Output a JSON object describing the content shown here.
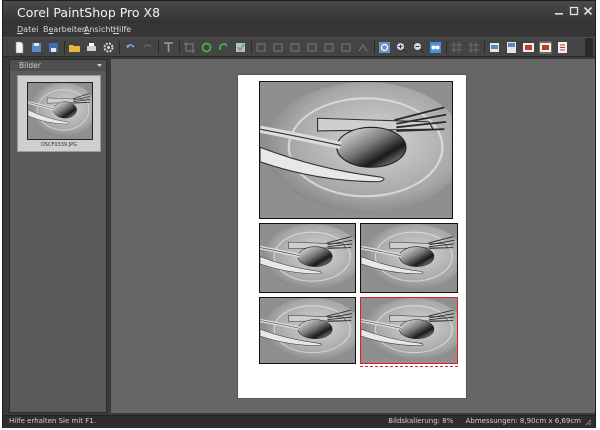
{
  "app": {
    "title": "Corel PaintShop Pro X8"
  },
  "menu": [
    {
      "label": "Datei",
      "accel": "D"
    },
    {
      "label": "Bearbeiten",
      "accel": "e"
    },
    {
      "label": "Ansicht",
      "accel": "A"
    },
    {
      "label": "Hilfe",
      "accel": "H"
    }
  ],
  "sidebar": {
    "title": "Bilder",
    "thumbnail_caption": "DSCF0339.JPG"
  },
  "toolbar": {
    "icons": [
      "new-icon",
      "save-icon",
      "save-as-icon",
      "open-icon",
      "print-icon",
      "settings-icon",
      "undo-icon",
      "redo-icon",
      "text-icon",
      "crop-icon",
      "rotate-right-icon",
      "rotate-left-icon",
      "fit-icon",
      "align-left-icon",
      "align-center-icon",
      "align-right-icon",
      "align-top-icon",
      "align-bottom-icon",
      "distribute-icon",
      "zoom-fit-icon",
      "zoom-in-icon",
      "zoom-out-icon",
      "actual-size-icon",
      "grid-icon",
      "snap-icon",
      "template-icon",
      "layout-icon",
      "preview-icon",
      "close-preview-icon",
      "extra-icon"
    ]
  },
  "status": {
    "help": "Hilfe erhalten Sie mit F1.",
    "scale": "Bildskalierung: 8%",
    "dimensions": "Abmessungen: 8,90cm x 6,69cm"
  },
  "colors": {
    "selection": "#e02020",
    "accent_blue": "#4a90d9"
  }
}
